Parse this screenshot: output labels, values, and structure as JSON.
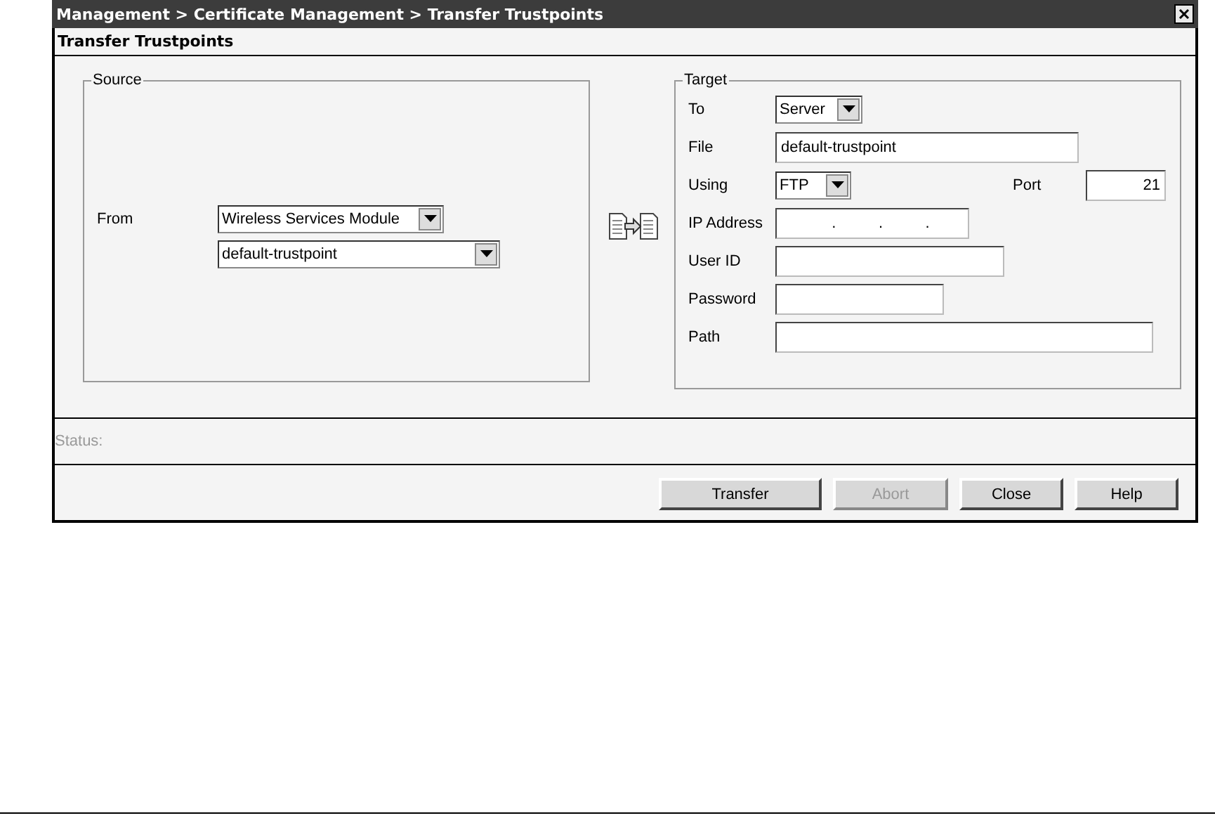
{
  "window": {
    "title": "Management > Certificate Management > Transfer Trustpoints"
  },
  "panel": {
    "title": "Transfer Trustpoints"
  },
  "source": {
    "legend": "Source",
    "from_label": "From",
    "from_value": "Wireless Services Module",
    "trustpoint_value": "default-trustpoint"
  },
  "target": {
    "legend": "Target",
    "fields": [
      {
        "label": "To",
        "kind": "select",
        "value": "Server"
      },
      {
        "label": "File",
        "kind": "text",
        "value": "default-trustpoint"
      },
      {
        "label": "Using",
        "kind": "select",
        "value": "FTP",
        "port": {
          "label": "Port",
          "value": "21"
        }
      },
      {
        "label": "IP Address",
        "kind": "ip",
        "separators": [
          ".",
          ".",
          "."
        ]
      },
      {
        "label": "User ID",
        "kind": "text"
      },
      {
        "label": "Password",
        "kind": "password"
      },
      {
        "label": "Path",
        "kind": "text"
      }
    ]
  },
  "status": {
    "label": "Status:"
  },
  "buttons": [
    {
      "label": "Transfer",
      "disabled": false
    },
    {
      "label": "Abort",
      "disabled": true
    },
    {
      "label": "Close",
      "disabled": false
    },
    {
      "label": "Help",
      "disabled": false
    }
  ]
}
